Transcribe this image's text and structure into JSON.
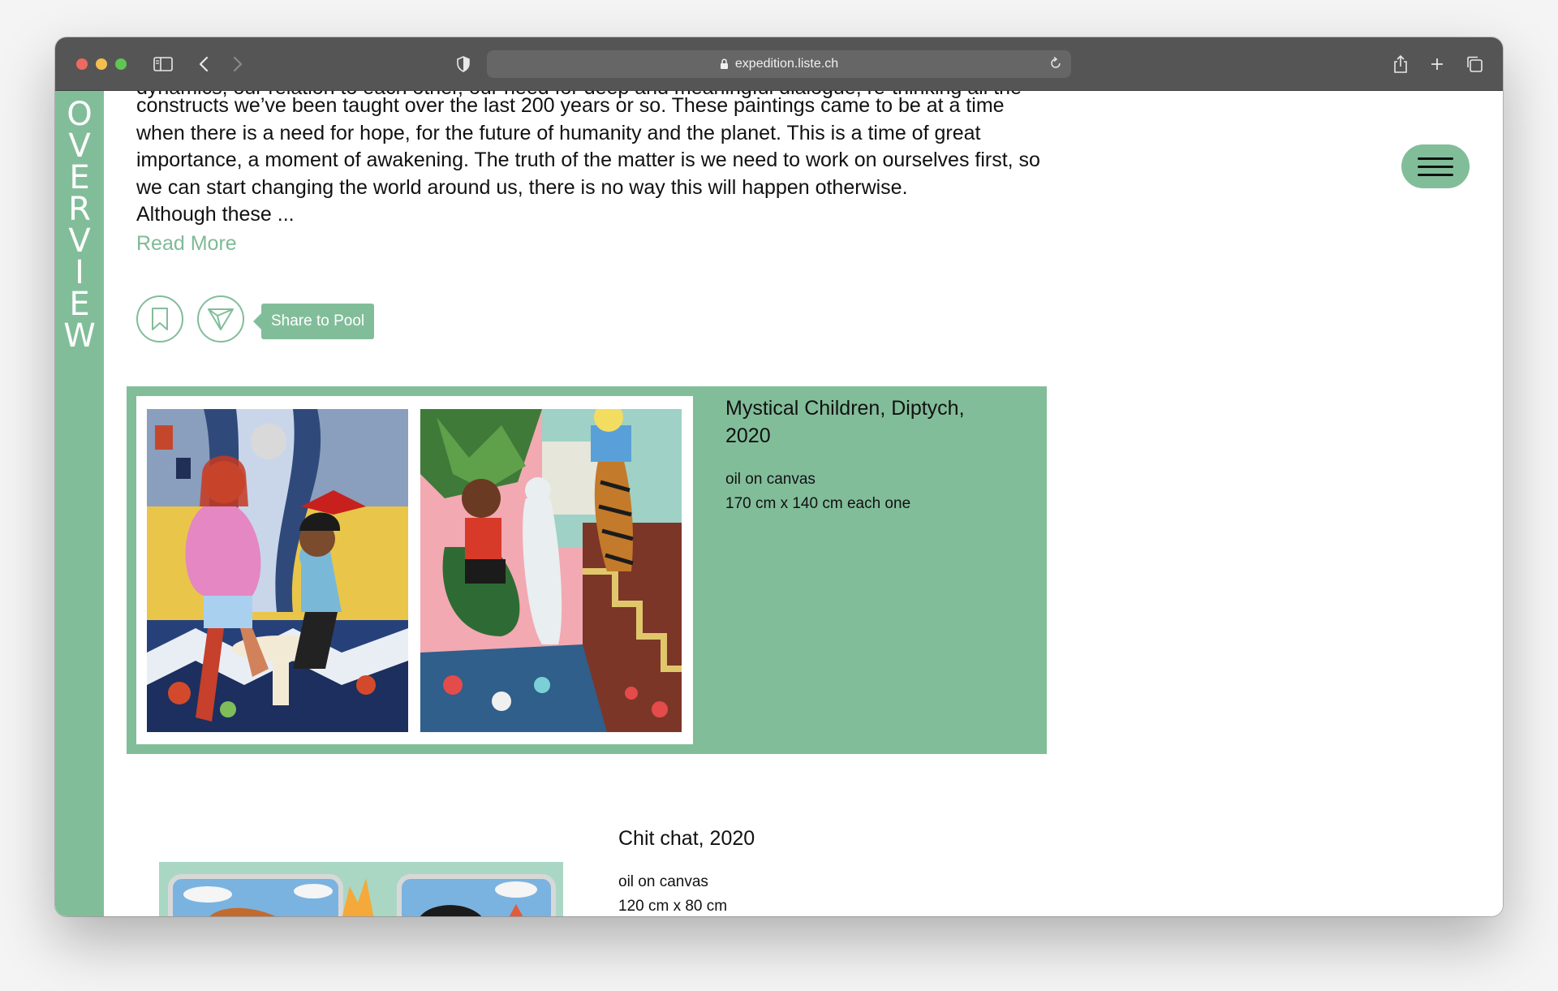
{
  "browser": {
    "url": "expedition.liste.ch"
  },
  "sidebar": {
    "letters": [
      "O",
      "V",
      "E",
      "R",
      "V",
      "I",
      "E",
      "W"
    ]
  },
  "intro": {
    "cutoff_line": "dynamics, our relation to each other, our need for deep and meaningful dialogue, re-thinking all the",
    "lines": [
      "constructs we’ve been taught over the last 200 years or so. These paintings came to be at a time",
      "when there is a need for hope, for the future of humanity and the planet. This is a time of great",
      "importance, a moment of awakening. The truth of the matter is we need to work on ourselves first, so",
      "we can start changing the world around us, there is no way this will happen otherwise.",
      "Although these ..."
    ],
    "read_more": "Read More"
  },
  "actions": {
    "share_tooltip": "Share to Pool"
  },
  "artworks": [
    {
      "title": "Mystical Children, Diptych, 2020",
      "medium": "oil on canvas",
      "dimensions": "170 cm x 140 cm each one"
    },
    {
      "title": "Chit chat, 2020",
      "medium": "oil on canvas",
      "dimensions": "120 cm x 80 cm"
    }
  ],
  "colors": {
    "accent": "#82bd9a",
    "link": "#7fba97",
    "titlebar": "#555555"
  }
}
